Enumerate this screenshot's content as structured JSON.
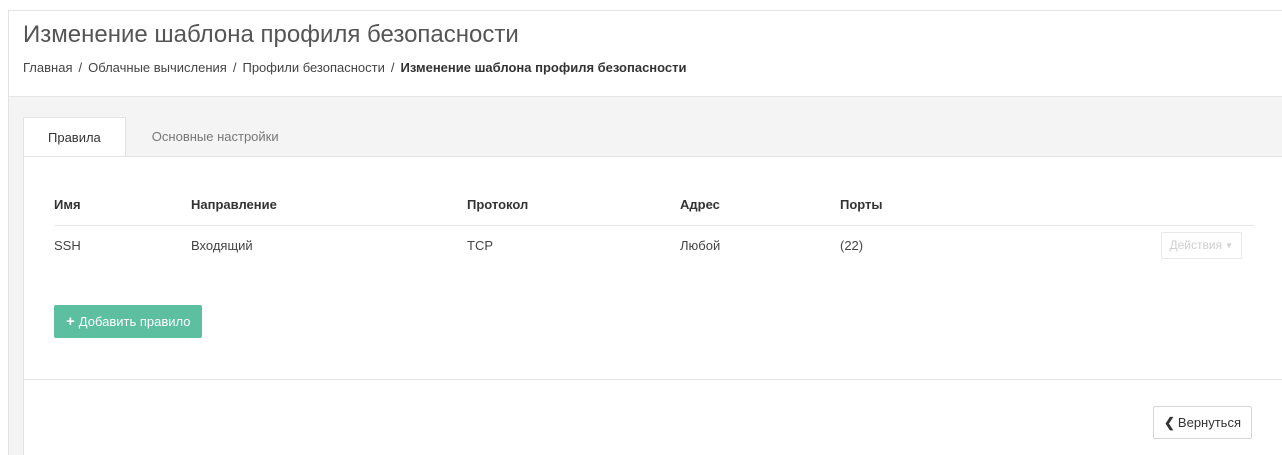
{
  "header": {
    "title": "Изменение шаблона профиля безопасности",
    "breadcrumb": {
      "items": [
        "Главная",
        "Облачные вычисления",
        "Профили безопасности"
      ],
      "current": "Изменение шаблона профиля безопасности",
      "separator": "/"
    }
  },
  "tabs": [
    {
      "label": "Правила",
      "active": true
    },
    {
      "label": "Основные настройки",
      "active": false
    }
  ],
  "rules_table": {
    "columns": [
      "Имя",
      "Направление",
      "Протокол",
      "Адрес",
      "Порты"
    ],
    "rows": [
      {
        "name": "SSH",
        "direction": "Входящий",
        "protocol": "TCP",
        "address": "Любой",
        "ports": "(22)",
        "actions_label": "Действия"
      }
    ]
  },
  "buttons": {
    "add_rule": "Добавить правило",
    "back": "Вернуться"
  },
  "icons": {
    "add": "plus-icon",
    "back": "chevron-left-icon",
    "dropdown": "caret-down-icon"
  },
  "colors": {
    "add_button": "#5cbfa0",
    "page_background": "#f4f4f4"
  }
}
